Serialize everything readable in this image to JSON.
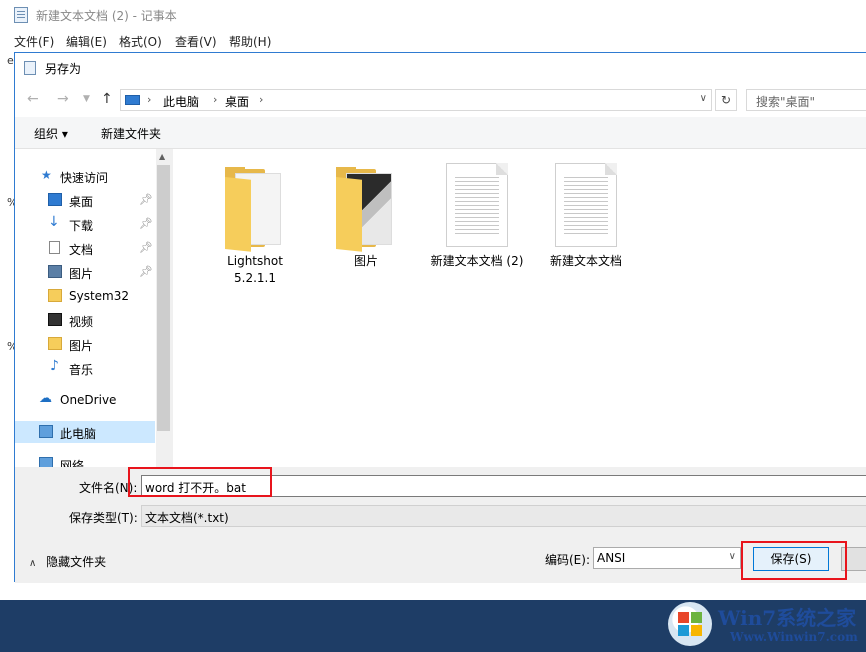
{
  "notepad": {
    "title": "新建文本文档 (2) - 记事本",
    "menu": [
      "文件(F)",
      "编辑(E)",
      "格式(O)",
      "查看(V)",
      "帮助(H)"
    ],
    "text_fragments": [
      "e",
      "%",
      "%"
    ]
  },
  "dialog": {
    "title": "另存为",
    "address": {
      "segments": [
        "此电脑",
        "桌面"
      ]
    },
    "search": {
      "placeholder": "搜索\"桌面\""
    },
    "toolbar": {
      "organize": "组织 ▾",
      "new_folder": "新建文件夹"
    },
    "nav": {
      "quick_access": "快速访问",
      "items": [
        {
          "label": "桌面",
          "icon": "desktop-icon",
          "pinned": true
        },
        {
          "label": "下载",
          "icon": "download-icon",
          "pinned": true
        },
        {
          "label": "文档",
          "icon": "document-icon",
          "pinned": true
        },
        {
          "label": "图片",
          "icon": "pictures-icon",
          "pinned": true
        },
        {
          "label": "System32",
          "icon": "folder-icon",
          "pinned": false
        },
        {
          "label": "视频",
          "icon": "video-icon",
          "pinned": false
        },
        {
          "label": "图片",
          "icon": "folder-icon",
          "pinned": false
        },
        {
          "label": "音乐",
          "icon": "music-icon",
          "pinned": false
        }
      ],
      "onedrive": "OneDrive",
      "this_pc": "此电脑",
      "network": "网络"
    },
    "files": [
      {
        "name_line1": "Lightshot",
        "name_line2": "5.2.1.1",
        "type": "folder"
      },
      {
        "name_line1": "图片",
        "name_line2": "",
        "type": "folder"
      },
      {
        "name_line1": "新建文本文档 (2)",
        "name_line2": "",
        "type": "text-document"
      },
      {
        "name_line1": "新建文本文档",
        "name_line2": "",
        "type": "text-document"
      }
    ],
    "filename": {
      "label": "文件名(N):",
      "value": "word 打不开。bat"
    },
    "filetype": {
      "label": "保存类型(T):",
      "value": "文本文档(*.txt)"
    },
    "hide_folders": "隐藏文件夹",
    "encoding": {
      "label": "编码(E):",
      "value": "ANSI"
    },
    "save_button": "保存(S)",
    "highlight_color": "#e8141c"
  },
  "watermark": {
    "title": "Win7系统之家",
    "url": "Www.Winwin7.com"
  }
}
